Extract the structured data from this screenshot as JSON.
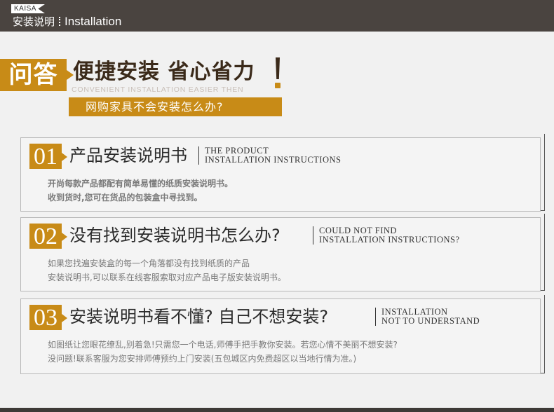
{
  "header": {
    "logo": "KAISA",
    "title_cn": "安装说明",
    "title_en": "Installation"
  },
  "hero": {
    "qa_label": "问答",
    "slogan": "便捷安装 省心省力",
    "slogan_en": "CONVENIENT INSTALLATION EASIER THEN",
    "question": "网购家具不会安装怎么办?"
  },
  "items": [
    {
      "number": "01",
      "title": "产品安装说明书",
      "en_line1": "THE PRODUCT",
      "en_line2": "INSTALLATION INSTRUCTIONS",
      "desc_line1": "开尚每款产品都配有简单易懂的纸质安装说明书。",
      "desc_line2": "收到货时,您可在货品的包装盒中寻找到。"
    },
    {
      "number": "02",
      "title": "没有找到安装说明书怎么办?",
      "en_line1": "COULD NOT FIND",
      "en_line2": "INSTALLATION INSTRUCTIONS?",
      "desc_line1": "如果您找遍安装盒的每一个角落都没有找到纸质的产品",
      "desc_line2": "安装说明书,可以联系在线客服索取对应产品电子版安装说明书。"
    },
    {
      "number": "03",
      "title": "安装说明书看不懂? 自己不想安装?",
      "en_line1": "INSTALLATION",
      "en_line2": "NOT TO UNDERSTAND",
      "desc_line1": "如图纸让您眼花缭乱,别着急!只需您一个电话,师傅手把手教你安装。若您心情不美丽不想安装?",
      "desc_line2": "没问题!联系客服为您安排师傅预约上门安装(五包城区内免费超区以当地行情为准。)"
    }
  ],
  "colors": {
    "accent": "#c88b17",
    "header_bg": "#4a4440",
    "dark_text": "#3b2a1a"
  }
}
